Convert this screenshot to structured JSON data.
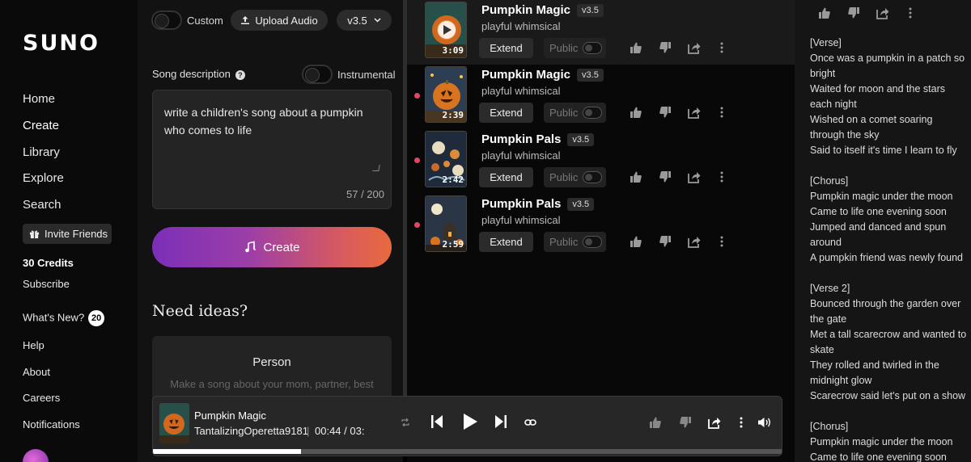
{
  "sidebar": {
    "logo": "SUNO",
    "nav": [
      "Home",
      "Create",
      "Library",
      "Explore",
      "Search"
    ],
    "invite_label": "Invite Friends",
    "credits": "30 Credits",
    "subscribe": "Subscribe",
    "whats_new": "What's New?",
    "whats_new_count": "20",
    "help": "Help",
    "about": "About",
    "careers": "Careers",
    "notifications": "Notifications"
  },
  "create_panel": {
    "custom_label": "Custom",
    "upload_label": "Upload Audio",
    "version": "v3.5",
    "description_label": "Song description",
    "instrumental_label": "Instrumental",
    "description_value": "write a children's song about a pumpkin who comes to life",
    "char_count": "57 / 200",
    "create_label": "Create",
    "ideas_title": "Need ideas?",
    "idea_card": {
      "title": "Person",
      "description": "Make a song about your mom, partner, best"
    }
  },
  "songs": [
    {
      "title": "Pumpkin Magic",
      "version": "v3.5",
      "style": "playful whimsical",
      "duration": "3:09",
      "extend": "Extend",
      "public": "Public",
      "playing": true
    },
    {
      "title": "Pumpkin Magic",
      "version": "v3.5",
      "style": "playful whimsical",
      "duration": "2:39",
      "extend": "Extend",
      "public": "Public",
      "playing": false
    },
    {
      "title": "Pumpkin Pals",
      "version": "v3.5",
      "style": "playful whimsical",
      "duration": "2:42",
      "extend": "Extend",
      "public": "Public",
      "playing": false
    },
    {
      "title": "Pumpkin Pals",
      "version": "v3.5",
      "style": "playful whimsical",
      "duration": "2:59",
      "extend": "Extend",
      "public": "Public",
      "playing": false
    }
  ],
  "lyrics": "[Verse]\nOnce was a pumpkin in a patch so bright\nWaited for moon and the stars each night\nWished on a comet soaring through the sky\nSaid to itself it's time I learn to fly\n\n[Chorus]\nPumpkin magic under the moon\nCame to life one evening soon\nJumped and danced and spun around\nA pumpkin friend was newly found\n\n[Verse 2]\nBounced through the garden over the gate\nMet a tall scarecrow and wanted to skate\nThey rolled and twirled in the midnight glow\nScarecrow said let's put on a show\n\n[Chorus]\nPumpkin magic under the moon\nCame to life one evening soon",
  "player": {
    "title": "Pumpkin Magic",
    "artist": "TantalizingOperetta9181",
    "separator": "|",
    "time": "00:44 / 03:",
    "progress": 0.235
  },
  "colors": {
    "accent_dot": "#e0456a",
    "create_gradient_start": "#7b2fb8",
    "create_gradient_end": "#e86a3d"
  },
  "icons": [
    "help-icon",
    "upload-icon",
    "chevron-down-icon",
    "music-note-icon",
    "gift-icon",
    "thumbs-up-icon",
    "thumbs-down-icon",
    "share-icon",
    "more-icon",
    "repeat-icon",
    "previous-icon",
    "play-icon",
    "next-icon",
    "link-icon",
    "volume-icon"
  ]
}
